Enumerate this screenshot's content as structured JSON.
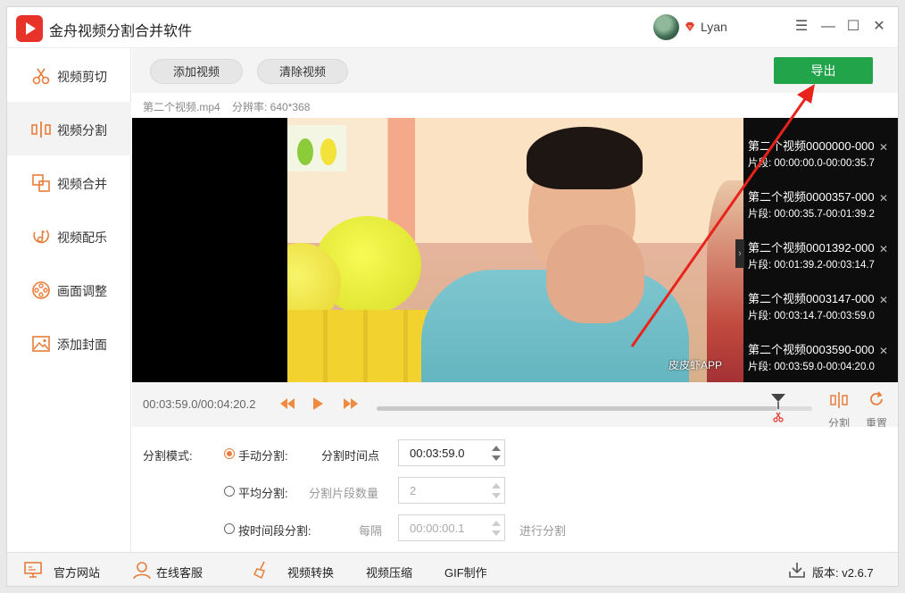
{
  "app": {
    "title": "金舟视频分割合并软件"
  },
  "user": {
    "name": "Lyan"
  },
  "window_controls": {
    "menu": "☰",
    "minimize": "—",
    "maximize": "☐",
    "close": "✕"
  },
  "sidebar": {
    "items": [
      {
        "label": "视频剪切",
        "icon": "scissors-icon"
      },
      {
        "label": "视频分割",
        "icon": "split-icon"
      },
      {
        "label": "视频合并",
        "icon": "merge-icon"
      },
      {
        "label": "视频配乐",
        "icon": "music-icon"
      },
      {
        "label": "画面调整",
        "icon": "film-reel-icon"
      },
      {
        "label": "添加封面",
        "icon": "image-icon"
      }
    ],
    "active_index": 1
  },
  "toolbar": {
    "add_video": "添加视频",
    "clear_video": "清除视频",
    "export": "导出"
  },
  "file_info": {
    "filename": "第二个视频.mp4",
    "resolution": "分辨率: 640*368"
  },
  "video": {
    "watermark": "皮皮虾APP"
  },
  "segments": [
    {
      "name": "第二个视频0000000-000",
      "time": "片段:  00:00:00.0-00:00:35.7"
    },
    {
      "name": "第二个视频0000357-000",
      "time": "片段:  00:00:35.7-00:01:39.2"
    },
    {
      "name": "第二个视频0001392-000",
      "time": "片段:  00:01:39.2-00:03:14.7"
    },
    {
      "name": "第二个视频0003147-000",
      "time": "片段:  00:03:14.7-00:03:59.0"
    },
    {
      "name": "第二个视频0003590-000",
      "time": "片段:  00:03:59.0-00:04:20.0"
    }
  ],
  "playback": {
    "timecode": "00:03:59.0/00:04:20.2",
    "progress": 0.918,
    "split_label": "分割",
    "reset_label": "重置"
  },
  "split_settings": {
    "mode_label": "分割模式:",
    "manual": {
      "label": "手动分割:",
      "field_label": "分割时间点",
      "value": "00:03:59.0",
      "selected": true
    },
    "average": {
      "label": "平均分割:",
      "field_label": "分割片段数量",
      "value": "2",
      "selected": false
    },
    "by_interval": {
      "label": "按时间段分割:",
      "field_label": "每隔",
      "value": "00:00:00.1",
      "action_label": "进行分割",
      "selected": false
    }
  },
  "footer": {
    "website": "官方网站",
    "support": "在线客服",
    "convert": "视频转换",
    "compress": "视频压缩",
    "gif": "GIF制作",
    "version": "版本: v2.6.7"
  },
  "colors": {
    "accent_orange": "#e87d3b",
    "export_green": "#22a54a",
    "annotation_red": "#e8231c"
  }
}
